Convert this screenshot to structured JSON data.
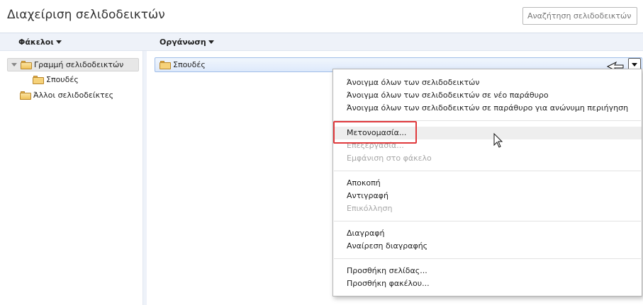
{
  "header": {
    "title": "Διαχείριση σελιδοδεικτών",
    "search_placeholder": "Αναζήτηση σελιδοδεικτών"
  },
  "toolbar": {
    "folders_label": "Φάκελοι",
    "organize_label": "Οργάνωση"
  },
  "tree": {
    "items": [
      {
        "label": "Γραμμή σελιδοδεικτών",
        "icon": "folder-open-icon",
        "selected": true,
        "expanded": true
      },
      {
        "label": "Σπουδές",
        "icon": "folder-icon"
      },
      {
        "label": "Άλλοι σελιδοδείκτες",
        "icon": "folder-open-icon"
      }
    ]
  },
  "list": {
    "rows": [
      {
        "label": "Σπουδές",
        "icon": "folder-icon"
      }
    ]
  },
  "context_menu": {
    "groups": [
      [
        {
          "label": "Άνοιγμα όλων των σελιδοδεικτών",
          "enabled": true
        },
        {
          "label": "Άνοιγμα όλων των σελιδοδεικτών σε νέο παράθυρο",
          "enabled": true
        },
        {
          "label": "Άνοιγμα όλων των σελιδοδεικτών σε παράθυρο για ανώνυμη περιήγηση",
          "enabled": true
        }
      ],
      [
        {
          "label": "Μετονομασία...",
          "enabled": true,
          "hovered": true
        },
        {
          "label": "Επεξεργασία...",
          "enabled": false
        },
        {
          "label": "Εμφάνιση στο φάκελο",
          "enabled": false
        }
      ],
      [
        {
          "label": "Αποκοπή",
          "enabled": true
        },
        {
          "label": "Αντιγραφή",
          "enabled": true
        },
        {
          "label": "Επικόλληση",
          "enabled": false
        }
      ],
      [
        {
          "label": "Διαγραφή",
          "enabled": true
        },
        {
          "label": "Αναίρεση διαγραφής",
          "enabled": true
        }
      ],
      [
        {
          "label": "Προσθήκη σελίδας...",
          "enabled": true
        },
        {
          "label": "Προσθήκη φακέλου...",
          "enabled": true
        }
      ]
    ]
  },
  "colors": {
    "highlight_border": "#e0393c",
    "selection_row": "#dde9fb",
    "disabled_text": "#a7a7a7"
  }
}
